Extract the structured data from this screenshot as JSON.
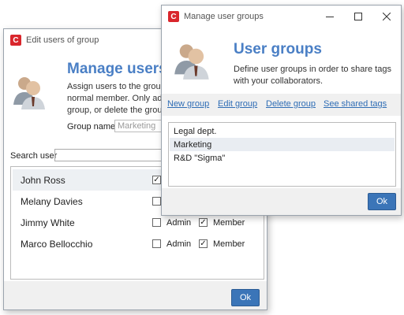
{
  "back_window": {
    "title": "Edit users of group",
    "heading": "Manage users",
    "description_lines": [
      "Assign users to the group a",
      "normal member. Only adm",
      "group, or delete the group"
    ],
    "group_name_label": "Group name",
    "group_name_value": "Marketing",
    "search_label": "Search user",
    "search_value": "",
    "admin_label": "Admin",
    "member_label": "Member",
    "users": [
      {
        "name": "John Ross",
        "admin": true,
        "member": null
      },
      {
        "name": "Melany Davies",
        "admin": false,
        "member": null
      },
      {
        "name": "Jimmy White",
        "admin": false,
        "member": true
      },
      {
        "name": "Marco Bellocchio",
        "admin": false,
        "member": true
      }
    ],
    "ok_label": "Ok"
  },
  "front_window": {
    "title": "Manage user groups",
    "heading": "User groups",
    "description_lines": [
      "Define user groups in order to share tags",
      "with your collaborators."
    ],
    "toolbar": {
      "new_group": "New group",
      "edit_group": "Edit group",
      "delete_group": "Delete group",
      "see_shared_tags": "See shared tags"
    },
    "groups": [
      {
        "name": "Legal dept.",
        "selected": false
      },
      {
        "name": "Marketing",
        "selected": true
      },
      {
        "name": "R&D \"Sigma\"",
        "selected": false
      }
    ],
    "ok_label": "Ok"
  },
  "icons": {
    "app_icon_letter": "C",
    "minimize": "minimize-icon",
    "maximize": "maximize-icon",
    "close": "close-icon",
    "users": "users-group-icon"
  },
  "colors": {
    "accent": "#4a7fc5",
    "button": "#3b75b8",
    "app_icon": "#d9262c",
    "selected_row": "#e9edf2"
  }
}
